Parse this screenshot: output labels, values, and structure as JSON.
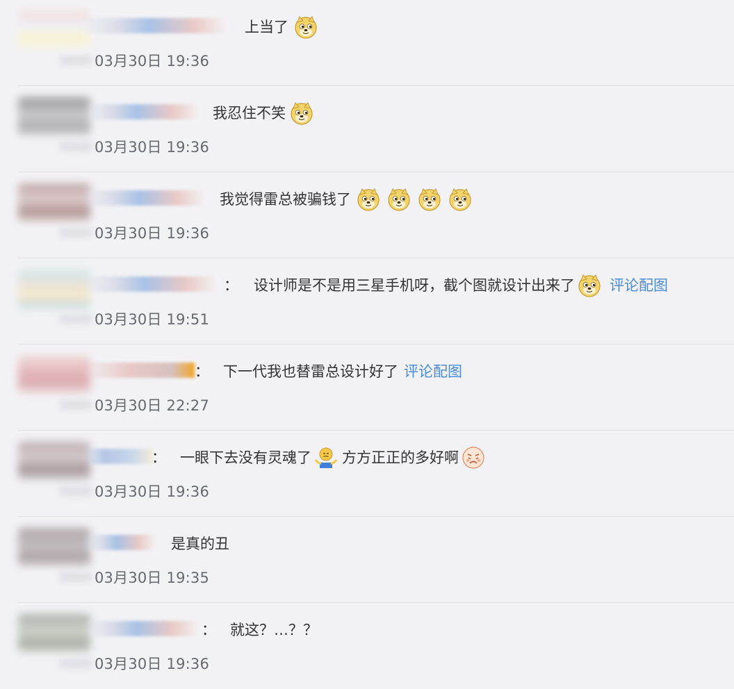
{
  "comments": [
    {
      "text": "上当了",
      "time": "03月30日 19:36",
      "link": "",
      "colon": ""
    },
    {
      "text": "我忍住不笑",
      "time": "03月30日 19:36",
      "link": "",
      "colon": ""
    },
    {
      "text": "我觉得雷总被骗钱了",
      "time": "03月30日 19:36",
      "link": "",
      "colon": ""
    },
    {
      "text": "设计师是不是用三星手机呀，截个图就设计出来了",
      "time": "03月30日 19:51",
      "link": "评论配图",
      "colon": "："
    },
    {
      "text": "下一代我也替雷总设计好了",
      "time": "03月30日 22:27",
      "link": "评论配图",
      "colon": "："
    },
    {
      "text": "一眼下去没有灵魂了",
      "text2": "方方正正的多好啊",
      "time": "03月30日 19:36",
      "link": "",
      "colon": "："
    },
    {
      "text": "是真的丑",
      "time": "03月30日 19:35",
      "link": "",
      "colon": ""
    },
    {
      "text": "就这？…？？",
      "time": "03月30日 19:36",
      "link": "",
      "colon": "："
    }
  ],
  "icons": {
    "doge": "doge-emoji",
    "shrug": "shrug-emoji",
    "angry": "angry-face-emoji"
  },
  "colors": {
    "background": "#f2f2f5",
    "link": "#4a8bd3",
    "time": "#666a70",
    "divider": "#e2e2e6"
  }
}
